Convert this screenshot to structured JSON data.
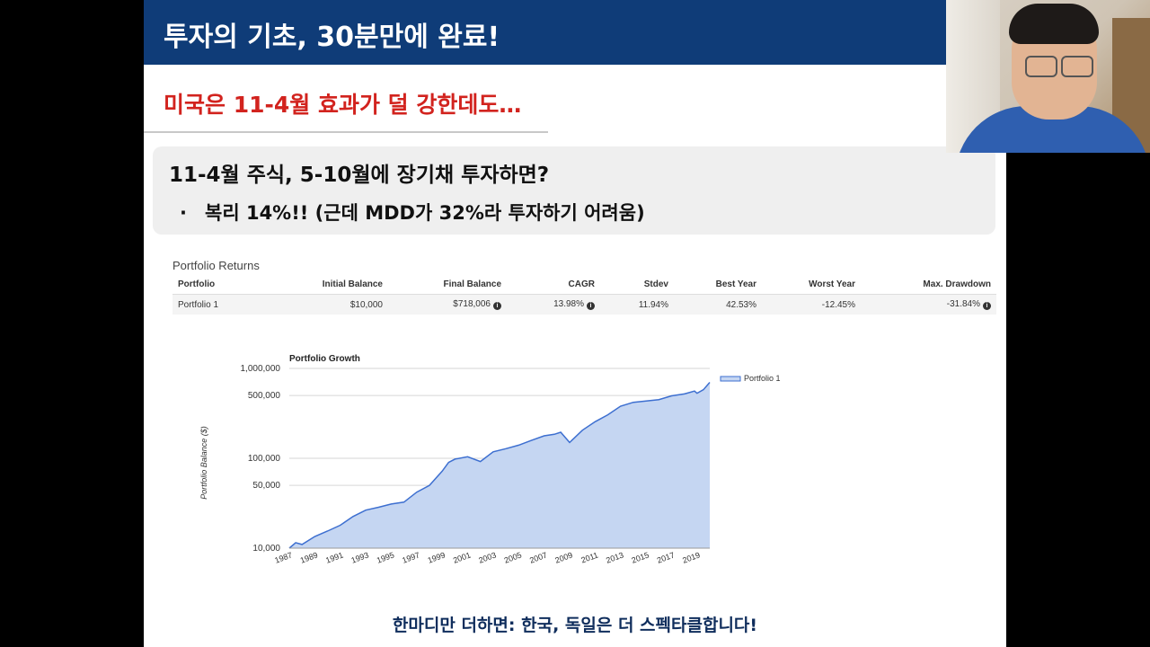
{
  "slide": {
    "title": "투자의 기초, 30분만에 완료!",
    "subtitle": "미국은 11-4월 효과가 덜 강한데도…",
    "callout_heading": "11-4월 주식, 5-10월에 장기채 투자하면?",
    "callout_bullet_marker": "·",
    "callout_bullet": "복리 14%!! (근데 MDD가 32%라 투자하기 어려움)",
    "footer": "한마디만 더하면: 한국, 독일은 더 스펙타클합니다!"
  },
  "portfolio_returns": {
    "title": "Portfolio Returns",
    "columns": [
      "Portfolio",
      "Initial Balance",
      "Final Balance",
      "CAGR",
      "Stdev",
      "Best Year",
      "Worst Year",
      "Max. Drawdown"
    ],
    "rows": [
      {
        "portfolio": "Portfolio 1",
        "initial_balance": "$10,000",
        "final_balance": "$718,006",
        "cagr": "13.98%",
        "stdev": "11.94%",
        "best_year": "42.53%",
        "worst_year": "-12.45%",
        "max_drawdown": "-31.84%"
      }
    ],
    "info_icon": "info-circle-icon",
    "info_glyph": "i"
  },
  "chart_data": {
    "type": "area",
    "title": "Portfolio Growth",
    "ylabel": "Portfolio Balance ($)",
    "xlabel": "",
    "y_scale": "log",
    "ylim": [
      10000,
      1000000
    ],
    "xlim": [
      1987,
      2020
    ],
    "y_ticks": [
      {
        "value": 10000,
        "label": "10,000"
      },
      {
        "value": 50000,
        "label": "50,000"
      },
      {
        "value": 100000,
        "label": "100,000"
      },
      {
        "value": 500000,
        "label": "500,000"
      },
      {
        "value": 1000000,
        "label": "1,000,000"
      }
    ],
    "x_ticks": [
      "1987",
      "1989",
      "1991",
      "1993",
      "1995",
      "1997",
      "1999",
      "2001",
      "2003",
      "2005",
      "2007",
      "2009",
      "2011",
      "2013",
      "2015",
      "2017",
      "2019"
    ],
    "legend_position": "top-right",
    "grid": true,
    "series": [
      {
        "name": "Portfolio 1",
        "color": "#3d6fd0",
        "fill": "#c5d6f2",
        "x": [
          1987,
          1987.5,
          1988,
          1989,
          1990,
          1991,
          1992,
          1993,
          1994,
          1995,
          1996,
          1997,
          1998,
          1999,
          1999.5,
          2000,
          2001,
          2002,
          2003,
          2004,
          2005,
          2006,
          2007,
          2007.8,
          2008.3,
          2009,
          2010,
          2011,
          2012,
          2013,
          2014,
          2015,
          2016,
          2017,
          2018,
          2018.8,
          2019,
          2019.5,
          2020
        ],
        "y": [
          10000,
          11500,
          11000,
          13500,
          15500,
          18000,
          22500,
          26500,
          28500,
          31000,
          32500,
          42000,
          50000,
          72000,
          90000,
          98000,
          104000,
          92000,
          118000,
          128000,
          140000,
          158000,
          178000,
          185000,
          195000,
          150000,
          205000,
          255000,
          305000,
          380000,
          420000,
          435000,
          450000,
          495000,
          520000,
          560000,
          530000,
          580000,
          700000
        ]
      }
    ]
  },
  "webcam": {
    "label": "presenter-webcam"
  }
}
